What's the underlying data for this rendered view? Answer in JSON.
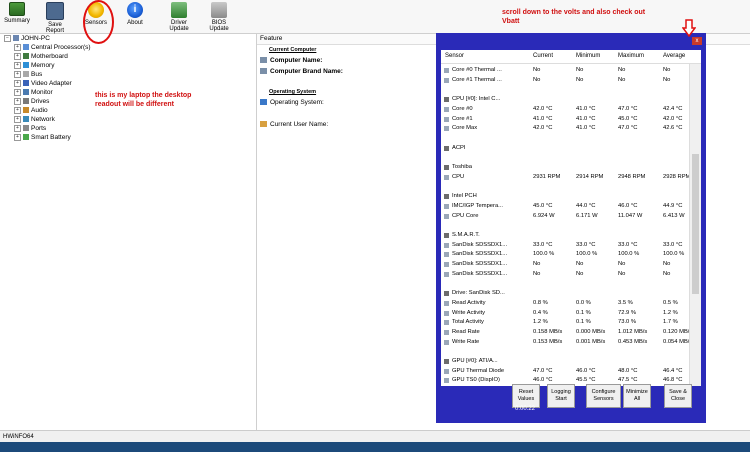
{
  "toolbar": {
    "summary": "Summary",
    "save_report": "Save Report",
    "sensors": "Sensors",
    "about": "About",
    "driver_update": "Driver Update",
    "bios_update": "BIOS Update"
  },
  "annotations": {
    "top": "scroll down to the volts and also check out Vbatt",
    "left": "this is my laptop the desktop readout will be different"
  },
  "tree": {
    "root": "JOHN-PC",
    "items": [
      "Central Processor(s)",
      "Motherboard",
      "Memory",
      "Bus",
      "Video Adapter",
      "Monitor",
      "Drives",
      "Audio",
      "Network",
      "Ports",
      "Smart Battery"
    ]
  },
  "feature": {
    "header": "Feature",
    "current_computer": "Current Computer",
    "computer_name": "Computer Name:",
    "computer_brand_name": "Computer Brand Name:",
    "operating_system_section": "Operating System",
    "operating_system": "Operating System:",
    "current_user_name": "Current User Name:"
  },
  "sensor_window": {
    "close": "x",
    "columns": [
      "Sensor",
      "Current",
      "Minimum",
      "Maximum",
      "Average"
    ],
    "rows": [
      {
        "name": "Core #0 Thermal ...",
        "cur": "No",
        "min": "No",
        "max": "No",
        "avg": "No"
      },
      {
        "name": "Core #1 Thermal ...",
        "cur": "No",
        "min": "No",
        "max": "No",
        "avg": "No"
      },
      {
        "name": "",
        "cur": "",
        "min": "",
        "max": "",
        "avg": ""
      },
      {
        "name": "CPU [#0]: Intel C...",
        "group": true
      },
      {
        "name": "Core #0",
        "cur": "42.0 °C",
        "min": "41.0 °C",
        "max": "47.0 °C",
        "avg": "42.4 °C"
      },
      {
        "name": "Core #1",
        "cur": "41.0 °C",
        "min": "41.0 °C",
        "max": "45.0 °C",
        "avg": "42.0 °C"
      },
      {
        "name": "Core Max",
        "cur": "42.0 °C",
        "min": "41.0 °C",
        "max": "47.0 °C",
        "avg": "42.6 °C"
      },
      {
        "name": "",
        "cur": "",
        "min": "",
        "max": "",
        "avg": ""
      },
      {
        "name": "ACPI",
        "group": true
      },
      {
        "name": "",
        "cur": "",
        "min": "",
        "max": "",
        "avg": ""
      },
      {
        "name": "Toshiba",
        "group": true
      },
      {
        "name": "CPU",
        "cur": "2931 RPM",
        "min": "2914 RPM",
        "max": "2948 RPM",
        "avg": "2928 RPM"
      },
      {
        "name": "",
        "cur": "",
        "min": "",
        "max": "",
        "avg": ""
      },
      {
        "name": "Intel PCH",
        "group": true
      },
      {
        "name": "IMC/IGP Tempera...",
        "cur": "45.0 °C",
        "min": "44.0 °C",
        "max": "46.0 °C",
        "avg": "44.9 °C"
      },
      {
        "name": "CPU Core",
        "cur": "6.924 W",
        "min": "6.171 W",
        "max": "11.047 W",
        "avg": "6.413 W"
      },
      {
        "name": "",
        "cur": "",
        "min": "",
        "max": "",
        "avg": ""
      },
      {
        "name": "S.M.A.R.T.",
        "group": true
      },
      {
        "name": "SanDisk SDSSDX1...",
        "cur": "33.0 °C",
        "min": "33.0 °C",
        "max": "33.0 °C",
        "avg": "33.0 °C"
      },
      {
        "name": "SanDisk SDSSDX1...",
        "cur": "100.0 %",
        "min": "100.0 %",
        "max": "100.0 %",
        "avg": "100.0 %"
      },
      {
        "name": "SanDisk SDSSDX1...",
        "cur": "No",
        "min": "No",
        "max": "No",
        "avg": "No"
      },
      {
        "name": "SanDisk SDSSDX1...",
        "cur": "No",
        "min": "No",
        "max": "No",
        "avg": "No"
      },
      {
        "name": "",
        "cur": "",
        "min": "",
        "max": "",
        "avg": ""
      },
      {
        "name": "Drive: SanDisk SD...",
        "group": true
      },
      {
        "name": "Read Activity",
        "cur": "0.8 %",
        "min": "0.0 %",
        "max": "3.5 %",
        "avg": "0.5 %"
      },
      {
        "name": "Write Activity",
        "cur": "0.4 %",
        "min": "0.1 %",
        "max": "72.9 %",
        "avg": "1.2 %"
      },
      {
        "name": "Total Activity",
        "cur": "1.2 %",
        "min": "0.1 %",
        "max": "73.0 %",
        "avg": "1.7 %"
      },
      {
        "name": "Read Rate",
        "cur": "0.158 MB/s",
        "min": "0.000 MB/s",
        "max": "1.012 MB/s",
        "avg": "0.120 MB/s"
      },
      {
        "name": "Write Rate",
        "cur": "0.153 MB/s",
        "min": "0.001 MB/s",
        "max": "0.453 MB/s",
        "avg": "0.054 MB/s"
      },
      {
        "name": "",
        "cur": "",
        "min": "",
        "max": "",
        "avg": ""
      },
      {
        "name": "GPU [#0]: ATI/A...",
        "group": true
      },
      {
        "name": "GPU Thermal Diode",
        "cur": "47.0 °C",
        "min": "46.0 °C",
        "max": "48.0 °C",
        "avg": "46.4 °C"
      },
      {
        "name": "GPU TS0 (DispIO)",
        "cur": "46.0 °C",
        "min": "45.5 °C",
        "max": "47.5 °C",
        "avg": "46.8 °C"
      }
    ],
    "buttons": [
      "Reset Values",
      "Logging Start",
      "Configure Sensors",
      "Minimize All",
      "Save & Close"
    ],
    "timer": "0:00:22"
  },
  "status_bar": "HWiNFO64",
  "colors": {
    "sensor_frame": "#2a2ab8",
    "annotation": "#d01010"
  }
}
